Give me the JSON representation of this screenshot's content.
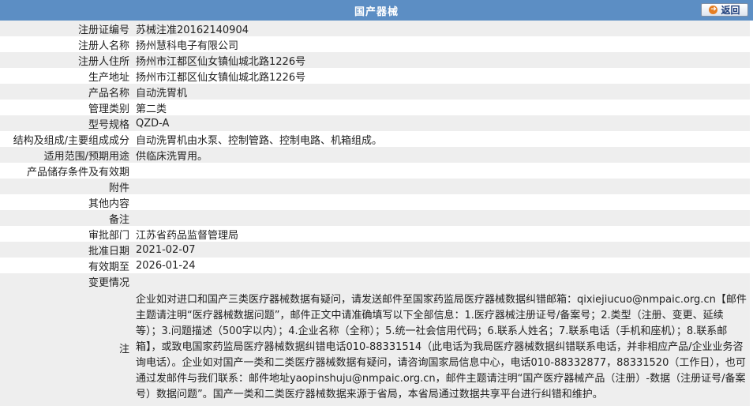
{
  "header": {
    "title": "国产器械",
    "back_label": "返回"
  },
  "rows": [
    {
      "label": "注册证编号",
      "value": "苏械注准20162140904"
    },
    {
      "label": "注册人名称",
      "value": "扬州慧科电子有限公司"
    },
    {
      "label": "注册人住所",
      "value": "扬州市江都区仙女镇仙城北路1226号"
    },
    {
      "label": "生产地址",
      "value": "扬州市江都区仙女镇仙城北路1226号"
    },
    {
      "label": "产品名称",
      "value": "自动洗胃机"
    },
    {
      "label": "管理类别",
      "value": "第二类"
    },
    {
      "label": "型号规格",
      "value": "QZD-A"
    },
    {
      "label": "结构及组成/主要组成成分",
      "value": "自动洗胃机由水泵、控制管路、控制电路、机箱组成。"
    },
    {
      "label": "适用范围/预期用途",
      "value": "供临床洗胃用。"
    },
    {
      "label": "产品储存条件及有效期",
      "value": ""
    },
    {
      "label": "附件",
      "value": ""
    },
    {
      "label": "其他内容",
      "value": ""
    },
    {
      "label": "备注",
      "value": ""
    },
    {
      "label": "审批部门",
      "value": "江苏省药品监督管理局"
    },
    {
      "label": "批准日期",
      "value": "2021-02-07"
    },
    {
      "label": "有效期至",
      "value": "2026-01-24"
    },
    {
      "label": "变更情况",
      "value": ""
    }
  ],
  "note": {
    "label": "注",
    "text": "企业如对进口和国产三类医疗器械数据有疑问，请发送邮件至国家药监局医疗器械数据纠错邮箱：qixiejiucuo@nmpaic.org.cn【邮件主题请注明“医疗器械数据问题”，邮件正文中请准确填写以下全部信息：1.医疗器械注册证号/备案号；2.类型（注册、变更、延续等）；3.问题描述（500字以内）；4.企业名称（全称）；5.统一社会信用代码；6.联系人姓名；7.联系电话（手机和座机）；8.联系邮箱】，或致电国家药监局医疗器械数据纠错电话010-88331514（此电话为我局医疗器械数据纠错联系电话，并非相应产品/企业业务咨询电话）。企业如对国产一类和二类医疗器械数据有疑问，请咨询国家局信息中心，电话010-88332877，88331520（工作日），也可通过发邮件与我们联系：邮件地址yaopinshuju@nmpaic.org.cn，邮件主题请注明“国产医疗器械产品（注册）-数据（注册证号/备案号）数据问题”。国产一类和二类医疗器械数据来源于省局，本省局通过数据共享平台进行纠错和维护。"
  }
}
